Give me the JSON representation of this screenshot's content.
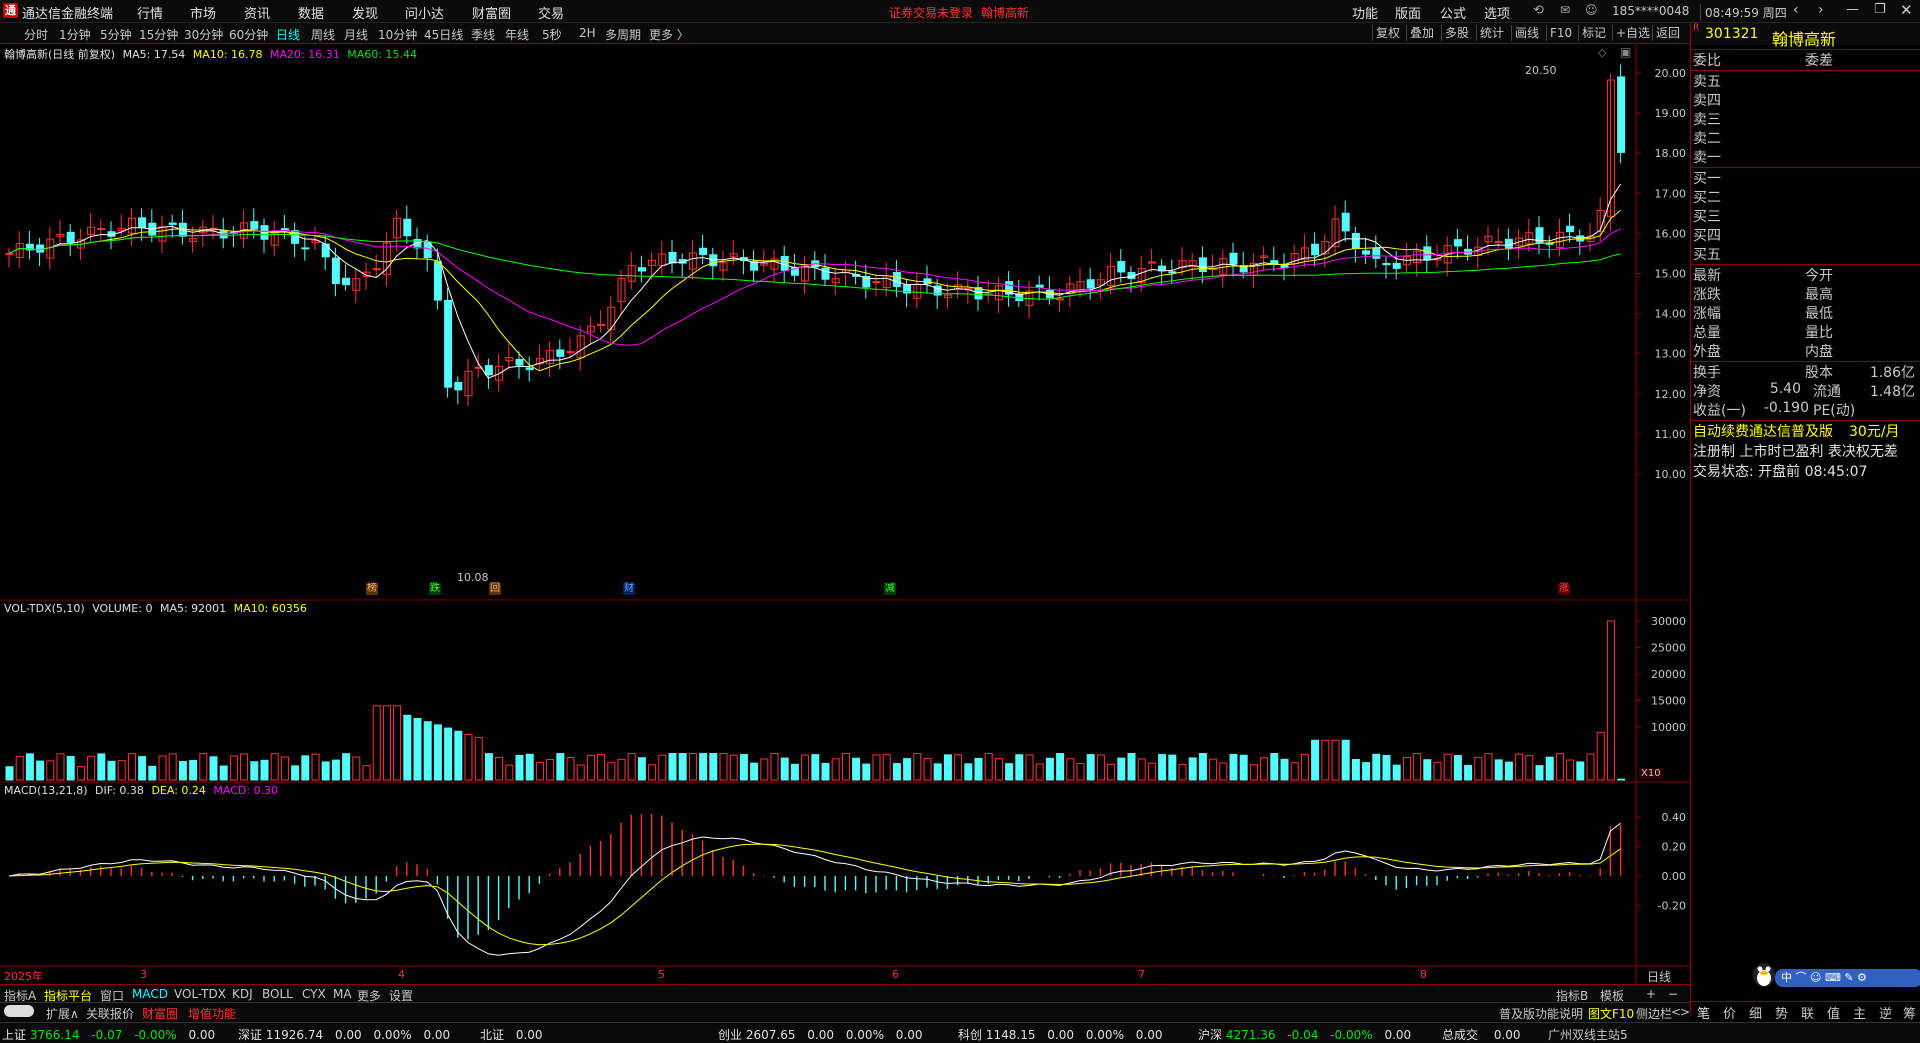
{
  "titlebar": {
    "app_title": "通达信金融终端",
    "menus": [
      "行情",
      "市场",
      "资讯",
      "数据",
      "发现",
      "问小达",
      "财富圈",
      "交易"
    ],
    "notice_a": "证券交易未登录",
    "notice_b": "翰博高新",
    "right_menus": [
      "功能",
      "版面",
      "公式",
      "选项"
    ],
    "account": "185****0048",
    "clock": "08:49:59 周四"
  },
  "periods": [
    "分时",
    "1分钟",
    "5分钟",
    "15分钟",
    "30分钟",
    "60分钟",
    "日线",
    "周线",
    "月线",
    "10分钟",
    "45日线",
    "季线",
    "年线",
    "5秒",
    "2H",
    "多周期",
    "更多 〉"
  ],
  "active_period": "日线",
  "toolbar_right": [
    "复权",
    "叠加",
    "多股",
    "统计",
    "画线",
    "F10",
    "标记",
    "+自选",
    "返回"
  ],
  "main_legend": {
    "name": "翰博高新(日线 前复权)",
    "ma5": "MA5: 17.54",
    "ma10": "MA10: 16.78",
    "ma20": "MA20: 16.31",
    "ma60": "MA60: 15.44"
  },
  "vol_legend": {
    "name": "VOL-TDX(5,10)",
    "volume": "VOLUME: 0",
    "ma5": "MA5: 92001",
    "ma10": "MA10: 60356"
  },
  "macd_legend": {
    "name": "MACD(13,21,8)",
    "dif": "DIF: 0.38",
    "dea": "DEA: 0.24",
    "macd": "MACD: 0.30"
  },
  "price_axis": [
    "20.00",
    "19.00",
    "18.00",
    "17.00",
    "16.00",
    "15.00",
    "14.00",
    "13.00",
    "12.00",
    "11.00",
    "10.00"
  ],
  "vol_axis": [
    "30000",
    "25000",
    "20000",
    "15000",
    "10000"
  ],
  "vol_unit": "X10",
  "macd_axis": [
    "0.40",
    "0.20",
    "0.00",
    "-0.20"
  ],
  "high_label": "20.50",
  "low_label": "10.08",
  "event_marks": [
    "榜",
    "跌",
    "回",
    "财",
    "减",
    "涨"
  ],
  "date_axis": [
    "2025年",
    "3",
    "4",
    "5",
    "6",
    "7",
    "8"
  ],
  "period_label": "日线",
  "colors": {
    "up": "#ff3232",
    "down": "#54fcfc",
    "ma5": "#ffffff",
    "ma10": "#ffff00",
    "ma20": "#ff00ff",
    "ma60": "#00ff00",
    "frame": "#8b0000"
  },
  "stock": {
    "code": "301321",
    "name": "翰博高新"
  },
  "order_book": {
    "header": {
      "left": "委比",
      "right": "委差"
    },
    "sells": [
      "卖五",
      "卖四",
      "卖三",
      "卖二",
      "卖一"
    ],
    "buys": [
      "买一",
      "买二",
      "买三",
      "买四",
      "买五"
    ]
  },
  "quote_rows": [
    {
      "l1": "最新",
      "l2": "今开"
    },
    {
      "l1": "涨跌",
      "l2": "最高"
    },
    {
      "l1": "涨幅",
      "l2": "最低"
    },
    {
      "l1": "总量",
      "l2": "量比"
    },
    {
      "l1": "外盘",
      "l2": "内盘"
    }
  ],
  "stats": [
    {
      "l1": "换手",
      "v1": "",
      "l2": "股本",
      "v2": "1.86亿"
    },
    {
      "l1": "净资",
      "v1": "5.40",
      "l2": "流通",
      "v2": "1.48亿"
    },
    {
      "l1": "收益(一)",
      "v1": "-0.190",
      "l2": "PE(动)",
      "v2": ""
    }
  ],
  "promo": {
    "text": "自动续费通达信普及版",
    "price": "30元/月"
  },
  "info_line": "注册制 上市时已盈利 表决权无差",
  "trade_status": "交易状态: 开盘前 08:45:07",
  "bottom_tabs1": [
    "指标A",
    "指标平台",
    "窗口",
    "MACD",
    "VOL-TDX",
    "KDJ",
    "BOLL",
    "CYX",
    "MA",
    "更多",
    "设置"
  ],
  "bottom_tabs1_right": [
    "指标B",
    "模板",
    "+",
    "−"
  ],
  "bottom_tabs2": [
    "扩展∧",
    "关联报价",
    "财富圈",
    "增值功能"
  ],
  "bottom_tabs2_right": [
    "普及版功能说明",
    "图文F10",
    "侧边栏",
    "<",
    ">"
  ],
  "right_tabs": [
    "笔",
    "价",
    "细",
    "势",
    "联",
    "值",
    "主",
    "逆",
    "筹"
  ],
  "status_indices": [
    {
      "name": "上证",
      "value": "3766.14",
      "chg": "-0.07",
      "pct": "-0.00%",
      "amt": "0.00"
    },
    {
      "name": "深证",
      "value": "11926.74",
      "chg": "0.00",
      "pct": "0.00%",
      "amt": "0.00"
    },
    {
      "name": "北证",
      "value": "0.00",
      "chg": "",
      "pct": "",
      "amt": ""
    },
    {
      "name": "创业",
      "value": "2607.65",
      "chg": "0.00",
      "pct": "0.00%",
      "amt": "0.00"
    },
    {
      "name": "科创",
      "value": "1148.15",
      "chg": "0.00",
      "pct": "0.00%",
      "amt": "0.00"
    },
    {
      "name": "沪深",
      "value": "4271.36",
      "chg": "-0.04",
      "pct": "-0.00%",
      "amt": "0.00"
    }
  ],
  "status_total": {
    "label": "总成交",
    "value": "0.00"
  },
  "status_site": "广州双线主站5"
}
